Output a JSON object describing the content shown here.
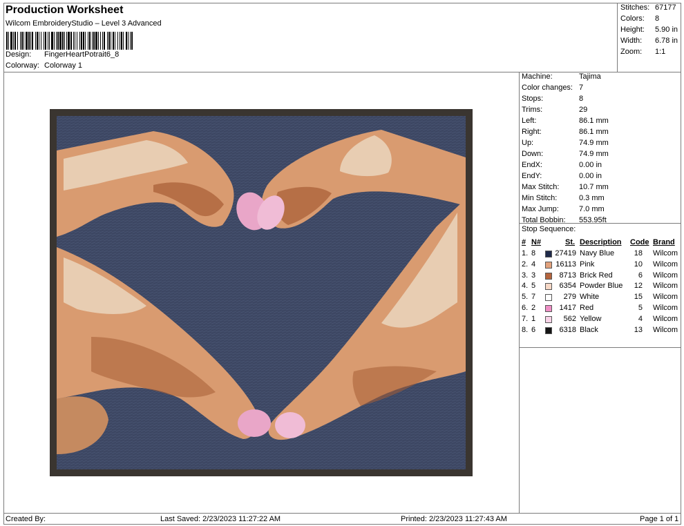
{
  "header": {
    "title": "Production Worksheet",
    "software": "Wilcom EmbroideryStudio – Level 3 Advanced",
    "design_label": "Design:",
    "design_value": "FingerHeartPotrait6_8",
    "colorway_label": "Colorway:",
    "colorway_value": "Colorway 1"
  },
  "stats": [
    {
      "label": "Stitches:",
      "value": "67177"
    },
    {
      "label": "Colors:",
      "value": "8"
    },
    {
      "label": "Height:",
      "value": "5.90 in"
    },
    {
      "label": "Width:",
      "value": "6.78 in"
    },
    {
      "label": "Zoom:",
      "value": "1:1"
    }
  ],
  "machine_info": [
    {
      "label": "Machine:",
      "value": "Tajima"
    },
    {
      "label": "Color changes:",
      "value": "7"
    },
    {
      "label": "Stops:",
      "value": "8"
    },
    {
      "label": "Trims:",
      "value": "29"
    },
    {
      "label": "Left:",
      "value": "86.1 mm"
    },
    {
      "label": "Right:",
      "value": "86.1 mm"
    },
    {
      "label": "Up:",
      "value": "74.9 mm"
    },
    {
      "label": "Down:",
      "value": "74.9 mm"
    },
    {
      "label": "EndX:",
      "value": "0.00 in"
    },
    {
      "label": "EndY:",
      "value": "0.00 in"
    },
    {
      "label": "Max Stitch:",
      "value": "10.7 mm"
    },
    {
      "label": "Min Stitch:",
      "value": "0.3 mm"
    },
    {
      "label": "Max Jump:",
      "value": "7.0 mm"
    },
    {
      "label": "Total Bobbin:",
      "value": "553.95ft"
    }
  ],
  "stop_sequence": {
    "title": "Stop Sequence:",
    "headers": {
      "num": "#",
      "n": "N#",
      "st": "St.",
      "desc": "Description",
      "code": "Code",
      "brand": "Brand"
    },
    "rows": [
      {
        "num": "1.",
        "n": "8",
        "color": "#1f2a4a",
        "st": "27419",
        "desc": "Navy Blue",
        "code": "18",
        "brand": "Wilcom"
      },
      {
        "num": "2.",
        "n": "4",
        "color": "#e2a27c",
        "st": "16113",
        "desc": "Pink",
        "code": "10",
        "brand": "Wilcom"
      },
      {
        "num": "3.",
        "n": "3",
        "color": "#b5653e",
        "st": "8713",
        "desc": "Brick Red",
        "code": "6",
        "brand": "Wilcom"
      },
      {
        "num": "4.",
        "n": "5",
        "color": "#f6d8c6",
        "st": "6354",
        "desc": "Powder Blue",
        "code": "12",
        "brand": "Wilcom"
      },
      {
        "num": "5.",
        "n": "7",
        "color": "#ffffff",
        "st": "279",
        "desc": "White",
        "code": "15",
        "brand": "Wilcom"
      },
      {
        "num": "6.",
        "n": "2",
        "color": "#ef8fc6",
        "st": "1417",
        "desc": "Red",
        "code": "5",
        "brand": "Wilcom"
      },
      {
        "num": "7.",
        "n": "1",
        "color": "#f9d4e8",
        "st": "562",
        "desc": "Yellow",
        "code": "4",
        "brand": "Wilcom"
      },
      {
        "num": "8.",
        "n": "6",
        "color": "#151515",
        "st": "6318",
        "desc": "Black",
        "code": "13",
        "brand": "Wilcom"
      }
    ]
  },
  "footer": {
    "created_by": "Created By:",
    "last_saved": "Last Saved: 2/23/2023 11:27:22 AM",
    "printed": "Printed: 2/23/2023 11:27:43 AM",
    "page": "Page 1 of 1"
  },
  "colors": {
    "background_fabric": "#3d4763",
    "border_frame": "#3a3530",
    "skin": "#d99b70",
    "skin_light": "#e8cdb2",
    "skin_shadow": "#a65c35",
    "nail": "#e9a6c8"
  }
}
